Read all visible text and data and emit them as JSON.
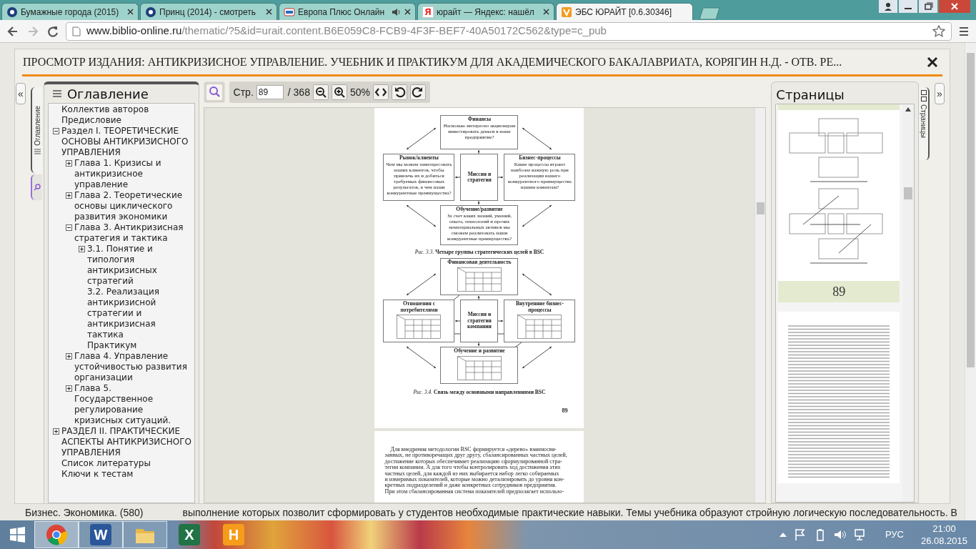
{
  "browser": {
    "tabs": [
      {
        "title": "Бумажные города (2015)",
        "kind": "film",
        "selected": false,
        "audio": false
      },
      {
        "title": "Принц (2014) - смотреть",
        "kind": "film",
        "selected": false,
        "audio": false
      },
      {
        "title": "Европа Плюс Онлайн",
        "kind": "radio",
        "selected": false,
        "audio": true
      },
      {
        "title": "юрайт — Яндекс: нашёл",
        "kind": "yandex",
        "glyph": "Я",
        "selected": false,
        "audio": false
      },
      {
        "title": "ЭБС ЮРАЙТ [0.6.30346]",
        "kind": "urait",
        "selected": true,
        "audio": false
      }
    ],
    "address": {
      "domain": "www.biblio-online.ru",
      "path": "/thematic/?5&id=urait.content.B6E059C8-FCB9-4F3F-BEF7-40A50172C562&type=c_pub"
    }
  },
  "viewer": {
    "title": "ПРОСМОТР ИЗДАНИЯ: АНТИКРИЗИСНОЕ УПРАВЛЕНИЕ. УЧЕБНИК И ПРАКТИКУМ ДЛЯ АКАДЕМИЧЕСКОГО БАКАЛАВРИАТА, КОРЯГИН Н.Д. - ОТВ. РЕ...",
    "collapse_left": "«",
    "collapse_right": "»",
    "side_tabs": [
      {
        "kind": "toc",
        "label": "Оглавление",
        "selected": true
      },
      {
        "kind": "search",
        "selected": false
      }
    ],
    "toc": {
      "title": "Оглавление",
      "items": [
        {
          "label": "Коллектив авторов"
        },
        {
          "label": "Предисловие"
        },
        {
          "label": "Раздел I. ТЕОРЕТИЧЕСКИЕ ОСНОВЫ АНТИКРИЗИСНОГО УПРАВЛЕНИЯ",
          "expanded": true,
          "children": [
            {
              "label": "Глава 1. Кризисы и антикризисное управление",
              "expanded": false
            },
            {
              "label": "Глава 2. Теоретические основы циклического развития экономики",
              "expanded": false
            },
            {
              "label": "Глава 3. Антикризисная стратегия и тактика",
              "expanded": true,
              "children": [
                {
                  "label": "3.1. Понятие и типология антикризисных стратегий",
                  "expanded": false
                },
                {
                  "label": "3.2. Реализация антикризисной стратегии и антикризисная тактика"
                },
                {
                  "label": "Практикум"
                }
              ]
            },
            {
              "label": "Глава 4. Управление устойчивостью развития организации",
              "expanded": false
            },
            {
              "label": "Глава 5. Государственное регулирование кризисных ситуаций.",
              "expanded": false
            }
          ]
        },
        {
          "label": "РАЗДЕЛ II. ПРАКТИЧЕСКИЕ АСПЕКТЫ АНТИКРИЗИСНОГО УПРАВЛЕНИЯ",
          "expanded": false
        },
        {
          "label": "Список литературы"
        },
        {
          "label": "Ключи к тестам"
        }
      ]
    },
    "toolbar": {
      "page_label": "Стр.",
      "page": "89",
      "total": "/ 368",
      "zoom": "50%"
    },
    "document": {
      "page": {
        "figures": [
          {
            "kind": "questions",
            "caption": "*Рис. 3.3.* **Четыре группы стратегических целей в BSC**",
            "boxes": [
              {
                "title": "Финансы",
                "body": "Насколько интересно акционерам инвестировать деньги в наше предприятие?"
              },
              {
                "title": "Рынок/клиенты",
                "body": "Чем мы можем заинтересовать наших клиентов, чтобы привлечь их и добиться требуемых финансовых результатов, в чем наши конкурентные преимущества?"
              },
              {
                "title": "Миссия и стратегия"
              },
              {
                "title": "Бизнес-процессы",
                "body": "Какие процессы играют наиболее важную роль при реализации нашего конкурентного преимущества нашим клиентам?"
              },
              {
                "title": "Обучение/развитие",
                "body": "За счет каких знаний, умений, опыта, технологий и прочих нематериальных активов мы сможем реализовать наши конкурентные преимущества?"
              }
            ]
          },
          {
            "kind": "grids",
            "caption": "*Рис. 3.4.* **Связь между основными направлениями BSC**",
            "boxes": [
              {
                "title": "Финансовая деятельность",
                "grid": true
              },
              {
                "title": "Отношения с потребителями",
                "grid": true
              },
              {
                "title": "Миссия и стратегия компании",
                "grid": false
              },
              {
                "title": "Внутренние бизнес-процессы",
                "grid": true
              },
              {
                "title": "Обучение и развитие",
                "grid": true
              }
            ]
          }
        ],
        "number": "89"
      },
      "next_page": {
        "lines": [
          "Для внедрения методологии BSC формируется «дерево» взаимосвя-",
          "занных, не противоречащих друг другу, сбалансированных частных целей,",
          "достижение которых обеспечивает реализацию сформулированной стра-",
          "тегии компании. А для того чтобы контролировать ход достижения этих",
          "частных целей, для каждой из них выбирается набор легко собираемых",
          "и измеримых показателей, которые можно детализировать до уровня кон-",
          "кретных подразделений и даже конкретных сотрудников предприятия.",
          "При этом сбалансированная система показателей предполагает использо-"
        ]
      }
    },
    "pages_panel": {
      "title": "Страницы",
      "tab": "Страницы",
      "thumbnails": [
        {
          "kind": "diagram",
          "label": "89",
          "selected": true
        },
        {
          "kind": "text",
          "selected": false
        }
      ]
    }
  },
  "background_text": [
    "Бизнес. Экономика. (580)",
    "выполнение которых позволит сформировать у студентов необходимые практические навыки. Темы учебника образуют стройную логическую последовательность. В"
  ],
  "taskbar": {
    "apps": [
      {
        "kind": "chrome",
        "selected": true,
        "running": true
      },
      {
        "kind": "word",
        "glyph": "W",
        "selected": false,
        "running": true
      },
      {
        "kind": "explorer",
        "selected": false,
        "running": true
      },
      {
        "kind": "excel",
        "glyph": "X",
        "selected": false,
        "running": false
      },
      {
        "kind": "app",
        "glyph": "H",
        "selected": false,
        "running": false
      }
    ],
    "language": "РУС",
    "time": "21:00",
    "date": "26.08.2015"
  }
}
